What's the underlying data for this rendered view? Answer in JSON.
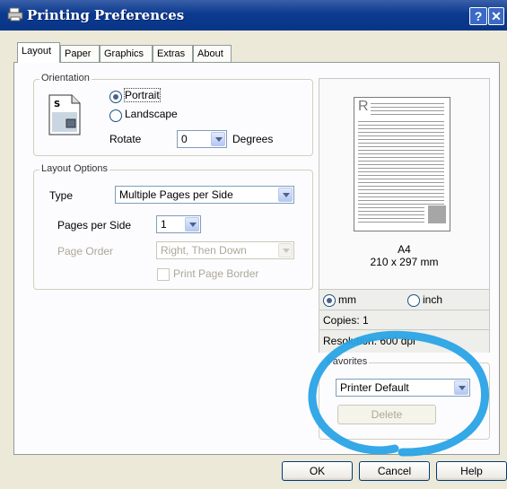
{
  "window": {
    "title": "Printing Preferences",
    "help_glyph": "?",
    "close_glyph": "✕"
  },
  "tabs": [
    {
      "label": "Layout",
      "active": true
    },
    {
      "label": "Paper"
    },
    {
      "label": "Graphics"
    },
    {
      "label": "Extras"
    },
    {
      "label": "About"
    }
  ],
  "orientation": {
    "legend": "Orientation",
    "portrait": "Portrait",
    "landscape": "Landscape",
    "selected": "portrait",
    "rotate_label": "Rotate",
    "rotate_value": "0",
    "degrees_label": "Degrees",
    "icon_letter": "S"
  },
  "layout_options": {
    "legend": "Layout Options",
    "type_label": "Type",
    "type_value": "Multiple Pages per Side",
    "pages_per_side_label": "Pages per Side",
    "pages_per_side_value": "1",
    "page_order_label": "Page Order",
    "page_order_value": "Right, Then Down",
    "print_border_label": "Print Page Border"
  },
  "preview": {
    "paper_letter": "R",
    "paper_size": "A4",
    "paper_dims": "210 x 297 mm",
    "unit_mm": "mm",
    "unit_inch": "inch",
    "unit_selected": "mm",
    "copies": "Copies: 1",
    "resolution": "Resolution: 600 dpi"
  },
  "favorites": {
    "legend": "Favorites",
    "value": "Printer Default",
    "delete_label": "Delete"
  },
  "buttons": {
    "ok": "OK",
    "cancel": "Cancel",
    "help": "Help"
  },
  "colors": {
    "title_bar": "#0b3a8f",
    "annotation_swirl": "#2aa3e6"
  }
}
